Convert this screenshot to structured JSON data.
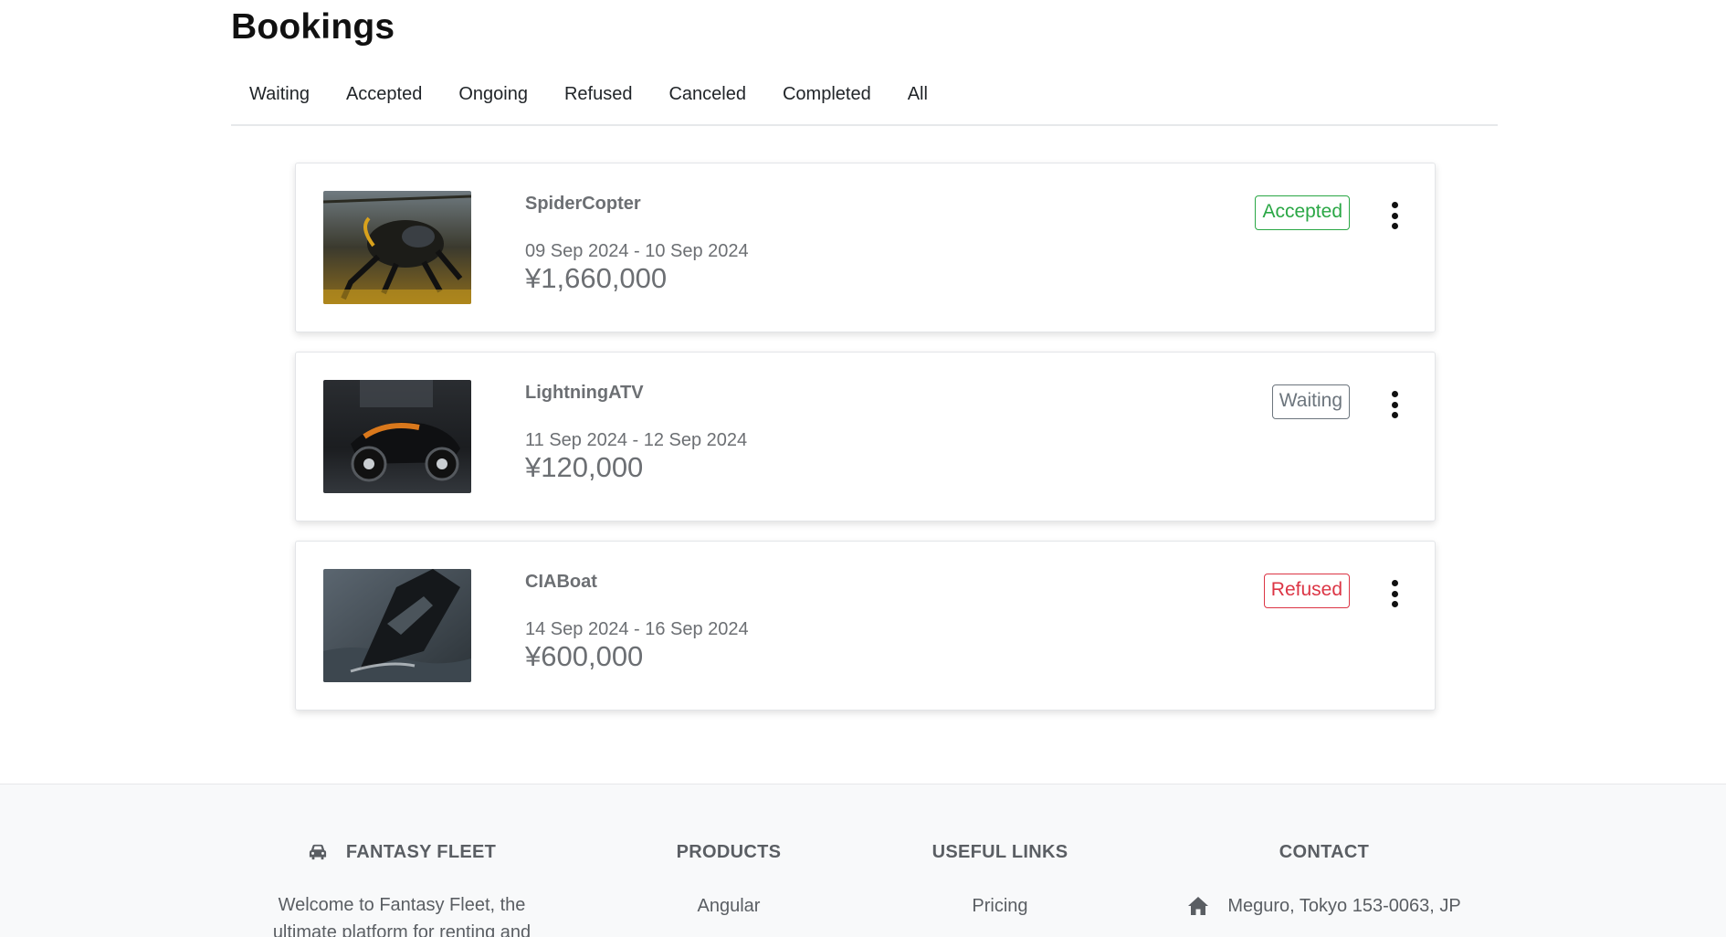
{
  "page": {
    "title": "Bookings"
  },
  "tabs": [
    {
      "label": "Waiting"
    },
    {
      "label": "Accepted"
    },
    {
      "label": "Ongoing"
    },
    {
      "label": "Refused"
    },
    {
      "label": "Canceled"
    },
    {
      "label": "Completed"
    },
    {
      "label": "All"
    }
  ],
  "bookings": [
    {
      "name": "SpiderCopter",
      "dates": "09 Sep 2024 - 10 Sep 2024",
      "price": "¥1,660,000",
      "status": "Accepted",
      "status_color": "#2aa745",
      "image_icon": "spider-copter-image"
    },
    {
      "name": "LightningATV",
      "dates": "11 Sep 2024 - 12 Sep 2024",
      "price": "¥120,000",
      "status": "Waiting",
      "status_color": "#6c757d",
      "image_icon": "lightning-atv-image"
    },
    {
      "name": "CIABoat",
      "dates": "14 Sep 2024 - 16 Sep 2024",
      "price": "¥600,000",
      "status": "Refused",
      "status_color": "#dc3545",
      "image_icon": "cia-boat-image"
    }
  ],
  "footer": {
    "brand": {
      "icon": "car-icon",
      "title": "FANTASY FLEET",
      "text_line1": "Welcome to Fantasy Fleet, the",
      "text_line2": "ultimate platform for renting and"
    },
    "products": {
      "title": "PRODUCTS",
      "items": [
        "Angular"
      ]
    },
    "useful_links": {
      "title": "USEFUL LINKS",
      "items": [
        "Pricing"
      ]
    },
    "contact": {
      "title": "CONTACT",
      "icon": "home-icon",
      "address": "Meguro, Tokyo 153-0063, JP"
    }
  }
}
